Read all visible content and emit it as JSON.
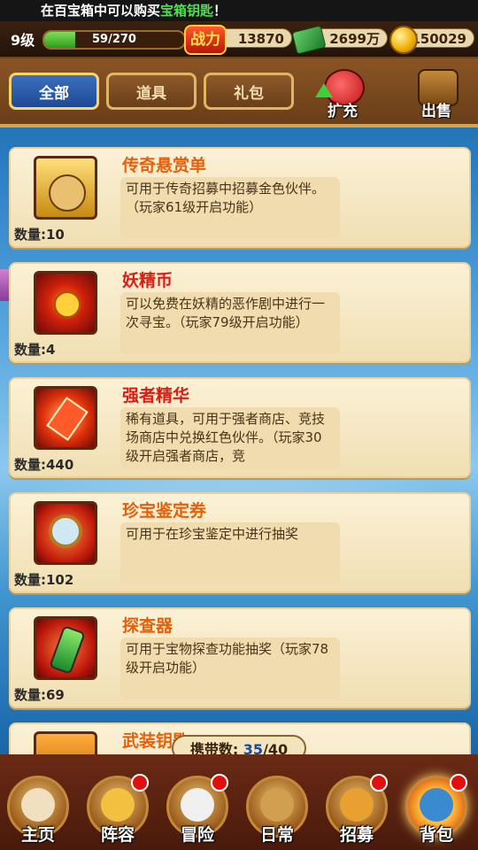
{
  "notice": {
    "prefix": "在百宝箱中可以购买",
    "highlight": "宝箱钥匙",
    "suffix": "！"
  },
  "status": {
    "level": "9级",
    "xp_text": "59/270",
    "xp_fraction": 0.2185,
    "power_icon_text": "战力",
    "power": "13870",
    "cash": "2699万",
    "gold": "150029"
  },
  "tabs": [
    {
      "label": "全部",
      "active": true
    },
    {
      "label": "道具",
      "active": false
    },
    {
      "label": "礼包",
      "active": false
    }
  ],
  "tools": {
    "expand_label": "扩充",
    "sell_label": "出售"
  },
  "items": [
    {
      "name": "传奇悬赏单",
      "desc": "可用于传奇招募中招募金色伙伴。（玩家61级开启功能）",
      "qty": "数量:10"
    },
    {
      "name": "妖精币",
      "desc": "可以免费在妖精的恶作剧中进行一次寻宝。（玩家79级开启功能）",
      "qty": "数量:4"
    },
    {
      "name": "强者精华",
      "desc": "稀有道具，可用于强者商店、竞技场商店中兑换红色伙伴。（玩家30级开启强者商店，竞",
      "qty": "数量:440"
    },
    {
      "name": "珍宝鉴定券",
      "desc": "可用于在珍宝鉴定中进行抽奖",
      "qty": "数量:102"
    },
    {
      "name": "探查器",
      "desc": "可用于宝物探查功能抽奖（玩家78级开启功能）",
      "qty": "数量:69"
    },
    {
      "name": "武装钥匙",
      "desc": "",
      "qty": ""
    }
  ],
  "carry": {
    "label": "携带数: ",
    "current": "35",
    "total": "/40"
  },
  "nav": [
    {
      "label": "主页",
      "dot": false
    },
    {
      "label": "阵容",
      "dot": true
    },
    {
      "label": "冒险",
      "dot": true
    },
    {
      "label": "日常",
      "dot": false
    },
    {
      "label": "招募",
      "dot": true
    },
    {
      "label": "背包",
      "dot": true
    }
  ]
}
